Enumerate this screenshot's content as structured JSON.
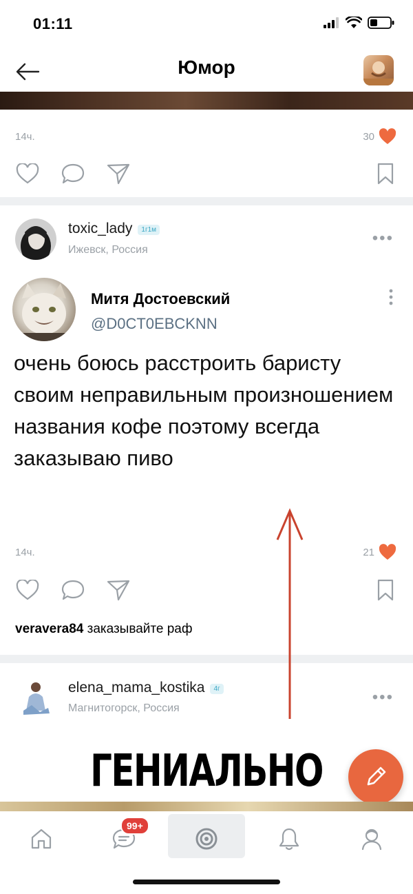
{
  "status_bar": {
    "time": "01:11"
  },
  "header": {
    "title": "Юмор"
  },
  "post1": {
    "time": "14ч.",
    "likes": "30"
  },
  "post2": {
    "username": "toxic_lady",
    "badge": "1г1м",
    "location": "Ижевск, Россия",
    "tweet": {
      "name": "Митя Достоевский",
      "handle": "@D0CT0EBCKNN",
      "text": "очень боюсь расстроить баристу своим неправильным произношением названия кофе поэтому всегда заказываю пиво"
    },
    "time": "14ч.",
    "likes": "21",
    "comment": {
      "user": "veravera84",
      "text": "заказывайте раф"
    }
  },
  "post3": {
    "username": "elena_mama_kostika",
    "badge": "4г",
    "location": "Магнитогорск, Россия"
  },
  "overlay_caption": "ГЕНИАЛЬНО",
  "tabbar": {
    "messages_badge": "99+"
  },
  "colors": {
    "accent": "#e8673f",
    "badge_red": "#e0403a",
    "arrow": "#c9432e"
  }
}
